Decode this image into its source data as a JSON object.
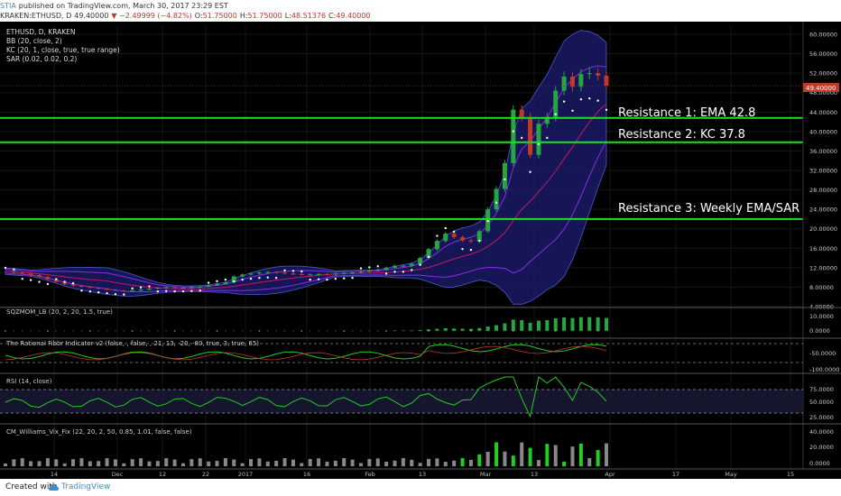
{
  "header": {
    "publisher": "STIA",
    "published_text": "published on TradingView.com, March 30, 2017 23:29 EST",
    "symbol": "KRAKEN:ETHUSD, D",
    "last": "49.40000",
    "change": "▼ −2.49999 (−4.82%)",
    "o_label": "O:",
    "o_value": "51.75000",
    "h_label": "H:",
    "h_value": "51.75000",
    "l_label": "L:",
    "l_value": "48.51376",
    "c_label": "C:",
    "c_value": "49.40000"
  },
  "legend": {
    "title": "ETHUSD, D, KRAKEN",
    "bb": "BB (20, close, 2)",
    "kc": "KC (20, 1, close, true, true range)",
    "sar": "SAR (0.02, 0.02, 0.2)"
  },
  "annotations": [
    {
      "text": "Resistance 1: EMA 42.8",
      "level": 42.8
    },
    {
      "text": "Resistance 2: KC 37.8",
      "level": 37.8
    },
    {
      "text": "Resistance 3: Weekly EMA/SAR",
      "level": 22.0
    }
  ],
  "price_label": "49.40000",
  "panes": {
    "sqz": {
      "title": "SQZMOM_LB (20, 2, 20, 1.5, true)",
      "ticks": [
        "10.0000",
        "0.0000"
      ]
    },
    "fisher": {
      "title": "The Rational Fibbr Indicator v2 (false, , false, , 21, 13, -20, -80, true, 3, true, 65)",
      "ticks": [
        "-50.0000",
        "-100.0000"
      ]
    },
    "rsi": {
      "title": "RSI (14, close)",
      "ticks": [
        "75.0000",
        "50.0000",
        "25.0000"
      ]
    },
    "vix": {
      "title": "CM_Williams_Vix_Fix (22, 20, 2, 50, 0.85, 1.01, false, false)",
      "ticks": [
        "40.0000",
        "20.0000",
        "0.0000"
      ]
    }
  },
  "colors": {
    "background": "#000000",
    "up": "#26a641",
    "down": "#c0392b",
    "resistance": "#22dd22",
    "bb_fill": "#1a1a66",
    "kc": "#8a2be2",
    "sar": "#ffffff",
    "rsi": "#22cc22",
    "vix_up": "#22cc22",
    "vix_norm": "#888888"
  },
  "footer": {
    "created_with": "Created with",
    "brand": "TradingView"
  },
  "chart_data": {
    "type": "candlestick",
    "symbol": "KRAKEN:ETHUSD",
    "timeframe": "D",
    "ylim": [
      4,
      60
    ],
    "y_ticks": [
      4,
      8,
      12,
      16,
      20,
      24,
      28,
      32,
      36,
      40,
      44,
      48,
      52,
      56,
      60
    ],
    "y_tick_labels": [
      "4.00000",
      "8.00000",
      "12.00000",
      "16.00000",
      "20.00000",
      "24.00000",
      "28.00000",
      "32.00000",
      "36.00000",
      "40.00000",
      "44.00000",
      "48.00000",
      "52.00000",
      "56.00000",
      "60.00000"
    ],
    "x_tick_labels": [
      "14",
      "Dec",
      "12",
      "22",
      "2017",
      "16",
      "Feb",
      "13",
      "Mar",
      "13",
      "Apr",
      "17",
      "May",
      "15"
    ],
    "horizontal_lines": [
      42.8,
      37.8,
      22.0
    ],
    "last_price": 49.4,
    "close_series": [
      11.3,
      11.0,
      10.8,
      10.5,
      10.1,
      9.6,
      9.1,
      8.6,
      8.3,
      8.1,
      7.9,
      7.7,
      7.5,
      7.3,
      7.2,
      7.3,
      7.5,
      7.7,
      7.9,
      8.0,
      7.9,
      7.9,
      8.0,
      8.1,
      8.4,
      8.7,
      9.0,
      10.2,
      10.6,
      10.8,
      11.0,
      11.1,
      11.0,
      10.8,
      10.7,
      10.6,
      10.6,
      10.7,
      10.6,
      10.8,
      10.9,
      11.0,
      11.2,
      11.4,
      11.6,
      12.0,
      12.4,
      12.4,
      12.8,
      14.0,
      15.8,
      17.5,
      19.0,
      18.3,
      17.6,
      17.4,
      19.5,
      24.0,
      28.2,
      33.5,
      44.5,
      43.0,
      35.2,
      41.6,
      43.0,
      48.4,
      51.3,
      49.2,
      51.8,
      52.0,
      51.5,
      49.4
    ],
    "series": [
      {
        "name": "SAR (0.02, 0.02, 0.2)",
        "type": "dots"
      },
      {
        "name": "BB (20, close, 2)",
        "type": "band"
      },
      {
        "name": "KC (20, 1, close, true, true range)",
        "type": "band"
      }
    ],
    "panes": [
      {
        "name": "SQZMOM_LB (20, 2, 20, 1.5, true)",
        "type": "histogram",
        "ticks": [
          0,
          10
        ]
      },
      {
        "name": "The Rational Fibbr Indicator v2",
        "type": "line",
        "ticks": [
          -50,
          -100
        ]
      },
      {
        "name": "RSI (14, close)",
        "type": "line",
        "ticks": [
          25,
          50,
          75
        ]
      },
      {
        "name": "CM_Williams_Vix_Fix (22, 20, 2, 50, 0.85, 1.01, false, false)",
        "type": "histogram",
        "ticks": [
          0,
          20,
          40
        ]
      }
    ]
  }
}
